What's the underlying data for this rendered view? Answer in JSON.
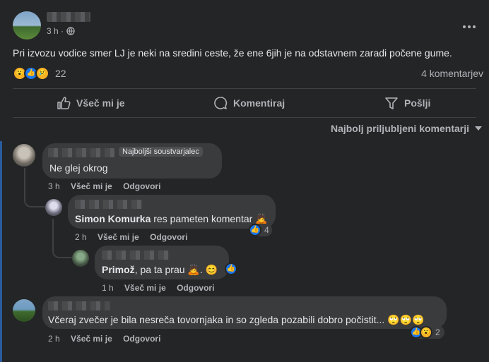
{
  "post": {
    "time": "3 h ·",
    "text": "Pri izvozu vodice smer LJ je neki na sredini ceste, že ene 6jih je na odstavnem zaradi počene gume.",
    "reaction_count": "22",
    "comment_count": "4 komentarjev"
  },
  "actions": {
    "like": "Všeč mi je",
    "comment": "Komentiraj",
    "share": "Pošlji"
  },
  "sort_label": "Najbolj priljubljeni komentarji",
  "comments": [
    {
      "badge": "Najboljši soustvarjalec",
      "text": "Ne glej okrog",
      "time": "3 h",
      "like": "Všeč mi je",
      "reply": "Odgovori"
    },
    {
      "mention": "Simon Komurka",
      "text": "res pameten komentar",
      "time": "2 h",
      "like": "Všeč mi je",
      "reply": "Odgovori",
      "reactions": "4"
    },
    {
      "mention": "Primož",
      "text": ", pa ta prau",
      "time": "1 h",
      "like": "Všeč mi je",
      "reply": "Odgovori"
    },
    {
      "text": "Včeraj zvečer je bila nesreča tovornjaka in so zgleda pozabili dobro počistit...",
      "time": "2 h",
      "like": "Všeč mi je",
      "reply": "Odgovori",
      "reactions": "2"
    }
  ],
  "colors": {
    "background": "#242526",
    "bubble": "#3a3b3c",
    "accent": "#2d88ff",
    "secondary_text": "#b0b3b8"
  },
  "icons": [
    "more-icon",
    "globe-icon",
    "thumbs-up-icon",
    "comment-icon",
    "share-icon",
    "caret-down-icon"
  ]
}
